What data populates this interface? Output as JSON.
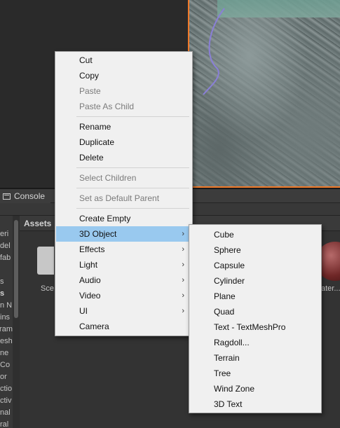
{
  "console_tab": {
    "label": "Console"
  },
  "assets_panel": {
    "header": "Assets",
    "items": [
      "Sce",
      "ater..."
    ]
  },
  "left_panel_items": [
    {
      "text": "eri",
      "bold": false
    },
    {
      "text": "del",
      "bold": false
    },
    {
      "text": "fab",
      "bold": false
    },
    {
      "text": "",
      "bold": false
    },
    {
      "text": "s",
      "bold": false
    },
    {
      "text": "s",
      "bold": true
    },
    {
      "text": "n N",
      "bold": false
    },
    {
      "text": "ins",
      "bold": false
    },
    {
      "text": "ram",
      "bold": false
    },
    {
      "text": "esh",
      "bold": false
    },
    {
      "text": "ne",
      "bold": false
    },
    {
      "text": "Co",
      "bold": false
    },
    {
      "text": "or",
      "bold": false
    },
    {
      "text": "ctio",
      "bold": false
    },
    {
      "text": "ctiv",
      "bold": false
    },
    {
      "text": "nal",
      "bold": false
    },
    {
      "text": "ral",
      "bold": false
    }
  ],
  "context_menu": {
    "items": [
      {
        "label": "Cut",
        "disabled": false
      },
      {
        "label": "Copy",
        "disabled": false
      },
      {
        "label": "Paste",
        "disabled": true
      },
      {
        "label": "Paste As Child",
        "disabled": true
      },
      {
        "label": "Rename",
        "disabled": false
      },
      {
        "label": "Duplicate",
        "disabled": false
      },
      {
        "label": "Delete",
        "disabled": false
      },
      {
        "label": "Select Children",
        "disabled": true
      },
      {
        "label": "Set as Default Parent",
        "disabled": true
      },
      {
        "label": "Create Empty",
        "disabled": false
      },
      {
        "label": "3D Object",
        "submenu": true,
        "highlighted": true
      },
      {
        "label": "Effects",
        "submenu": true
      },
      {
        "label": "Light",
        "submenu": true
      },
      {
        "label": "Audio",
        "submenu": true
      },
      {
        "label": "Video",
        "submenu": true
      },
      {
        "label": "UI",
        "submenu": true
      },
      {
        "label": "Camera",
        "disabled": false
      }
    ],
    "submenu_arrow": "›"
  },
  "submenu_3d_object": {
    "items": [
      "Cube",
      "Sphere",
      "Capsule",
      "Cylinder",
      "Plane",
      "Quad",
      "Text - TextMeshPro",
      "Ragdoll...",
      "Terrain",
      "Tree",
      "Wind Zone",
      "3D Text"
    ]
  },
  "colors": {
    "menu_bg": "#f0f0f0",
    "highlight": "#99c9ef",
    "disabled_text": "#7b7b7b",
    "scene_border": "#f07a2a"
  }
}
